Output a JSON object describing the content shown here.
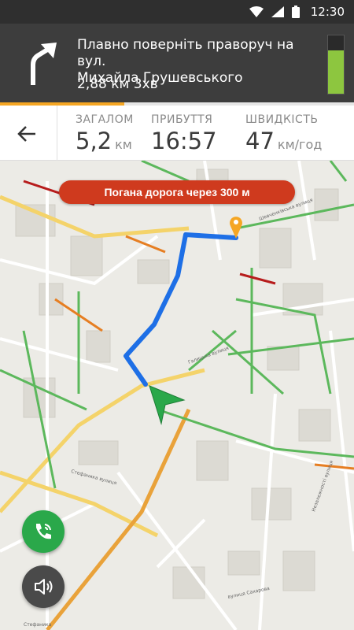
{
  "status_bar": {
    "time": "12:30"
  },
  "instruction": {
    "street_line1": "Плавно поверніть праворуч на вул.",
    "street_line2": "Михайла Грушевського",
    "distance_time": "2,88 км 3хв",
    "turn_icon": "turn-right-arrow-icon",
    "battery_level": 0.75
  },
  "route_progress": 0.35,
  "stats": {
    "total_label": "ЗАГАЛОМ",
    "total_value": "5,2",
    "total_unit": "км",
    "arrival_label": "ПРИБУТТЯ",
    "arrival_value": "16:57",
    "speed_label": "ШВИДКІСТЬ",
    "speed_value": "47",
    "speed_unit": "км/год"
  },
  "warning": {
    "text": "Погана дорога через 300 м",
    "color": "#cf3a1e"
  },
  "map": {
    "street_labels": [
      "Галицька вулиця",
      "Шевченківська вулиця",
      "Стефаника вулиця",
      "вулиця Сахарова",
      "Незалежності вулиця"
    ],
    "bottom_label": "Стефаника"
  },
  "colors": {
    "route": "#1e6fe6",
    "accent": "#f5a623",
    "position": "#2aa84a",
    "traffic_green": "#5cb85c",
    "traffic_red": "#b71c1c",
    "traffic_orange": "#e67e22"
  },
  "controls": {
    "call_icon": "phone-traffic-icon",
    "sound_icon": "speaker-icon"
  }
}
